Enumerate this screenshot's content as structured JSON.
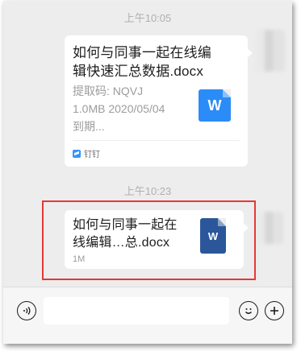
{
  "messages": [
    {
      "time": "上午10:05",
      "file_name": "如何与同事一起在线编辑快速汇总数据.docx",
      "title_lines": [
        "如何与同事一起在线编",
        "辑快速汇总数据.docx"
      ],
      "code_line": "提取码: NQVJ",
      "size_date_line": "1.0MB 2020/05/04",
      "expire_line": "到期...",
      "app_name": "钉钉",
      "icon_letter": "W",
      "icon_color": "#2b8cf7"
    },
    {
      "time": "上午10:23",
      "title_lines": [
        "如何与同事一起在",
        "线编辑…总.docx"
      ],
      "size": "1M",
      "icon_letter": "W",
      "icon_color": "#2b579a"
    }
  ],
  "input_bar": {
    "voice_icon": "voice-icon",
    "emoji_icon": "emoji-icon",
    "add_icon": "plus-icon"
  },
  "highlight_color": "#e53935"
}
